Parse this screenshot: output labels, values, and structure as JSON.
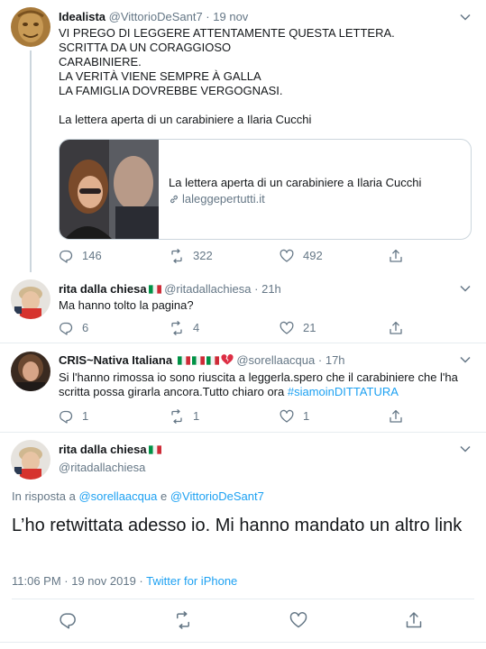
{
  "colors": {
    "text": "#14171a",
    "muted": "#657786",
    "link": "#1da1f2",
    "border": "#ccd6dd",
    "divider": "#e6ecf0"
  },
  "tweets": [
    {
      "name": "Idealista",
      "handle": "@VittorioDeSant7",
      "dot": "·",
      "time": "19 nov",
      "lines": [
        "VI PREGO DI LEGGERE ATTENTAMENTE QUESTA LETTERA.",
        "SCRITTA DA UN CORAGGIOSO",
        "CARABINIERE.",
        "LA VERITÀ VIENE SEMPRE À GALLA",
        "LA FAMIGLIA DOVREBBE VERGOGNASI.",
        "La lettera aperta di un carabiniere a Ilaria Cucchi"
      ],
      "card": {
        "title": "La lettera aperta di un carabiniere a Ilaria Cucchi",
        "domain": "laleggepertutti.it"
      },
      "replies": "146",
      "retweets": "322",
      "likes": "492",
      "icons": [
        "reply-icon",
        "retweet-icon",
        "like-icon",
        "share-icon"
      ]
    },
    {
      "name": "rita dalla chiesa",
      "handle": "@ritadallachiesa",
      "dot": "·",
      "time": "21h",
      "text": "Ma hanno tolto la pagina?",
      "replies": "6",
      "retweets": "4",
      "likes": "21"
    },
    {
      "name": "CRIS~Nativa Italiana",
      "handle": "@sorellaacqua",
      "dot": "·",
      "time": "17h",
      "line1": "Si l'hanno rimossa io sono riuscita a leggerla.spero che il carabiniere che l'ha",
      "line2": "scritta possa girarla ancora.Tutto chiaro ora ",
      "hashtag": "#siamoinDITTATURA",
      "replies": "1",
      "retweets": "1",
      "likes": "1"
    }
  ],
  "focus": {
    "name": "rita dalla chiesa",
    "handle": "@ritadallachiesa",
    "reply_prefix": "In risposta a ",
    "reply_user1": "@sorellaacqua",
    "reply_and": " e ",
    "reply_user2": "@VittorioDeSant7",
    "text": "L’ho retwittata adesso io. Mi hanno mandato un altro link",
    "time": "11:06 PM · 19 nov 2019",
    "dot": " · ",
    "source": "Twitter for iPhone"
  }
}
